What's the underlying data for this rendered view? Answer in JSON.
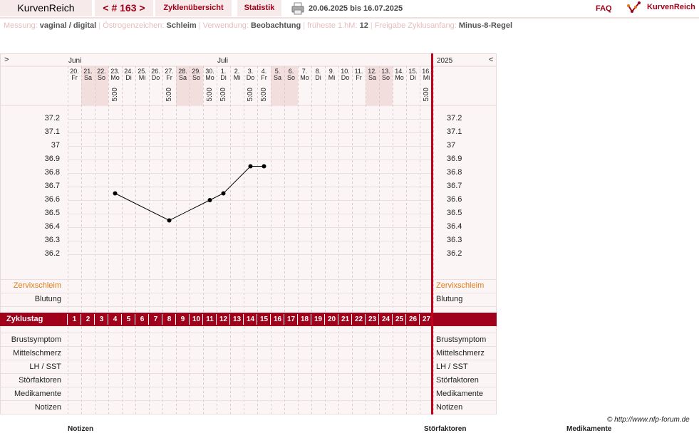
{
  "topbar": {
    "app_title": "KurvenReich",
    "cycle_label": "< # 163 >",
    "overview_label": "Zyklenübersicht",
    "stats_label": "Statistik",
    "date_range": "20.06.2025 bis 16.07.2025",
    "faq_label": "FAQ",
    "logo_text": "KurvenReich",
    "accent_color": "#a0001a"
  },
  "infobar": {
    "items": [
      {
        "label": "Messung:",
        "value": "vaginal / digital"
      },
      {
        "label": "Östrogenzeichen:",
        "value": "Schleim"
      },
      {
        "label": "Verwendung:",
        "value": "Beobachtung"
      },
      {
        "label": "früheste 1.hM:",
        "value": "12"
      },
      {
        "label": "Freigabe Zyklusanfang:",
        "value": "Minus-8-Regel"
      }
    ]
  },
  "chart_header": {
    "nav_prev": ">",
    "nav_next": "<",
    "month_june": "Juni",
    "month_july": "Juli",
    "year": "2025"
  },
  "days": [
    {
      "num": "20.",
      "wd": "Fr",
      "time": ""
    },
    {
      "num": "21.",
      "wd": "Sa",
      "time": "",
      "weekend": true
    },
    {
      "num": "22.",
      "wd": "So",
      "time": "",
      "weekend": true
    },
    {
      "num": "23.",
      "wd": "Mo",
      "time": "5:00"
    },
    {
      "num": "24.",
      "wd": "Di",
      "time": ""
    },
    {
      "num": "25.",
      "wd": "Mi",
      "time": ""
    },
    {
      "num": "26.",
      "wd": "Do",
      "time": ""
    },
    {
      "num": "27.",
      "wd": "Fr",
      "time": "5:00"
    },
    {
      "num": "28.",
      "wd": "Sa",
      "time": "",
      "weekend": true
    },
    {
      "num": "29.",
      "wd": "So",
      "time": "",
      "weekend": true
    },
    {
      "num": "30.",
      "wd": "Mo",
      "time": "5:00"
    },
    {
      "num": "1.",
      "wd": "Di",
      "time": "5:00"
    },
    {
      "num": "2.",
      "wd": "Mi",
      "time": ""
    },
    {
      "num": "3.",
      "wd": "Do",
      "time": "5:00"
    },
    {
      "num": "4.",
      "wd": "Fr",
      "time": "5:00"
    },
    {
      "num": "5.",
      "wd": "Sa",
      "time": "",
      "weekend": true
    },
    {
      "num": "6.",
      "wd": "So",
      "time": "",
      "weekend": true
    },
    {
      "num": "7.",
      "wd": "Mo",
      "time": ""
    },
    {
      "num": "8.",
      "wd": "Di",
      "time": ""
    },
    {
      "num": "9.",
      "wd": "Mi",
      "time": ""
    },
    {
      "num": "10.",
      "wd": "Do",
      "time": ""
    },
    {
      "num": "11.",
      "wd": "Fr",
      "time": ""
    },
    {
      "num": "12.",
      "wd": "Sa",
      "time": "",
      "weekend": true
    },
    {
      "num": "13.",
      "wd": "So",
      "time": "",
      "weekend": true
    },
    {
      "num": "14.",
      "wd": "Mo",
      "time": ""
    },
    {
      "num": "15.",
      "wd": "Di",
      "time": ""
    },
    {
      "num": "16.",
      "wd": "Mi",
      "time": "5:00"
    }
  ],
  "chart_data": {
    "type": "line",
    "ylim": [
      36.2,
      37.2
    ],
    "yticks": [
      "37.2",
      "37.1",
      "37",
      "36.9",
      "36.8",
      "36.7",
      "36.6",
      "36.5",
      "36.4",
      "36.3",
      "36.2"
    ],
    "points": [
      {
        "cycle_day": 4,
        "temp": 36.65
      },
      {
        "cycle_day": 8,
        "temp": 36.45
      },
      {
        "cycle_day": 11,
        "temp": 36.6
      },
      {
        "cycle_day": 12,
        "temp": 36.65
      },
      {
        "cycle_day": 14,
        "temp": 36.85
      },
      {
        "cycle_day": 15,
        "temp": 36.85
      }
    ],
    "line_color": "#000000"
  },
  "rows_upper": [
    "Zervixschleim",
    "Blutung"
  ],
  "zyklustag": {
    "label": "Zyklustag",
    "numbers": [
      "1",
      "2",
      "3",
      "4",
      "5",
      "6",
      "7",
      "8",
      "9",
      "10",
      "11",
      "12",
      "13",
      "14",
      "15",
      "16",
      "17",
      "18",
      "19",
      "20",
      "21",
      "22",
      "23",
      "24",
      "25",
      "26",
      "27"
    ]
  },
  "rows_lower": [
    "Brustsymptom",
    "Mittelschmerz",
    "LH / SST",
    "Störfaktoren",
    "Medikamente",
    "Notizen"
  ],
  "footer": {
    "copyright": "© http://www.nfp-forum.de",
    "cut_1": "Notizen",
    "cut_2": "Störfaktoren",
    "cut_3": "Medikamente"
  }
}
